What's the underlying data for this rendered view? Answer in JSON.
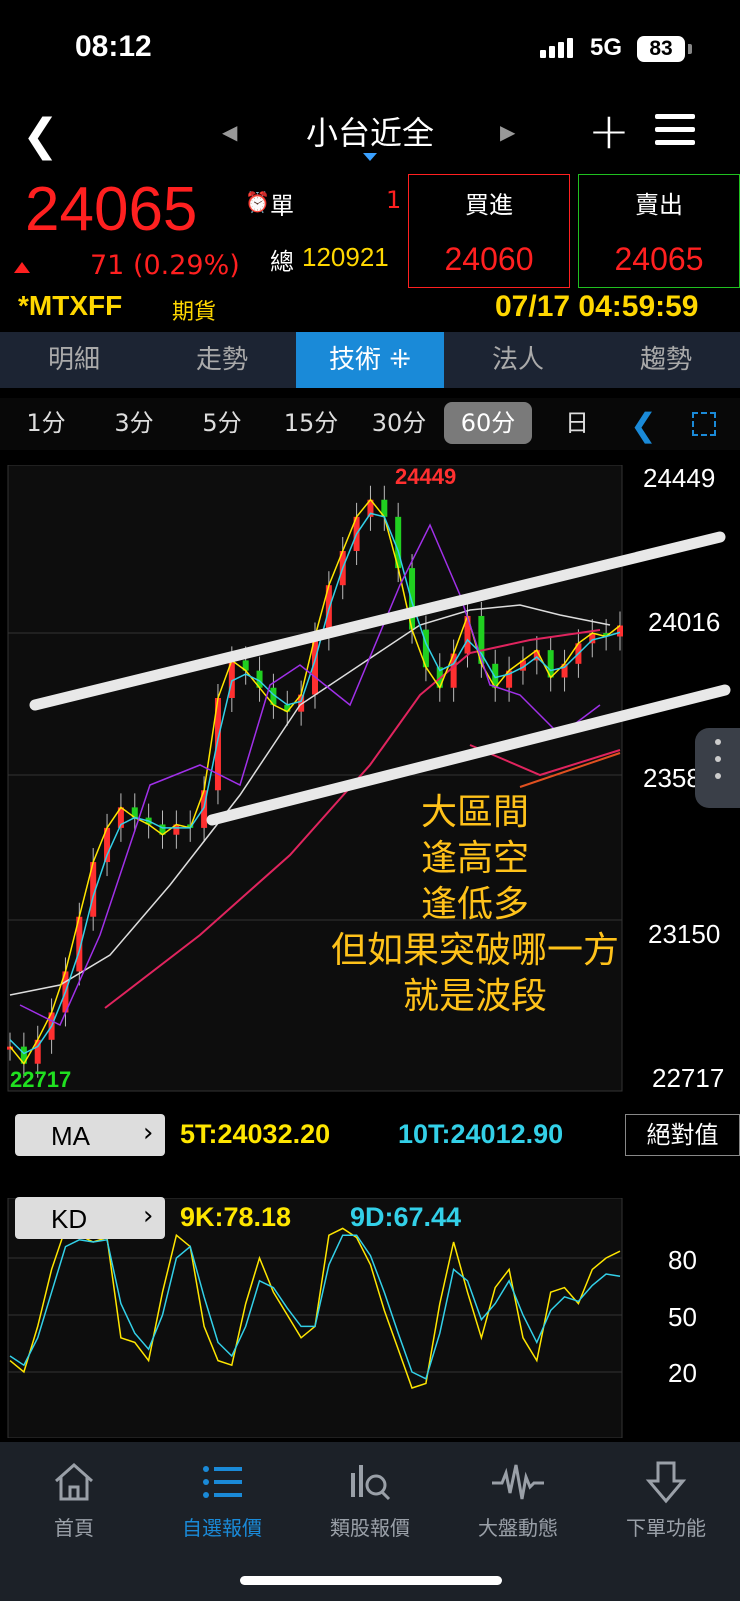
{
  "status": {
    "time": "08:12",
    "network": "5G",
    "battery": "83"
  },
  "nav": {
    "title": "小台近全",
    "back_icon": "back-chevron-icon",
    "prev_icon": "prev-arrow-icon",
    "next_icon": "next-arrow-icon",
    "add_icon": "plus-icon",
    "menu_icon": "menu-icon"
  },
  "quote": {
    "price": "24065",
    "change": "71 (0.29%)",
    "single_label": "單",
    "single_value": "1",
    "total_label": "總",
    "total_value": "120921",
    "buy_label": "買進",
    "buy_value": "24060",
    "sell_label": "賣出",
    "sell_value": "24065",
    "code": "*MTXFF",
    "kind": "期貨",
    "datetime": "07/17 04:59:59",
    "colors": {
      "up": "#ff2020",
      "accent": "#ffd700",
      "buy_border": "#ff2020",
      "sell_border": "#20c020"
    }
  },
  "tabs": [
    {
      "label": "明細"
    },
    {
      "label": "走勢"
    },
    {
      "label": "技術 ⁜"
    },
    {
      "label": "法人"
    },
    {
      "label": "趨勢"
    }
  ],
  "active_tab": 2,
  "periods": [
    {
      "label": "1分"
    },
    {
      "label": "3分"
    },
    {
      "label": "5分"
    },
    {
      "label": "15分"
    },
    {
      "label": "30分"
    },
    {
      "label": "60分"
    },
    {
      "label": "日"
    }
  ],
  "active_period": 5,
  "chart": {
    "price_axis": [
      "24449",
      "24016",
      "23583",
      "23150",
      "22717"
    ],
    "high_label": "24449",
    "low_label": "22717"
  },
  "ma": {
    "label": "MA",
    "ma5": "5T:24032.20",
    "ma10": "10T:24012.90",
    "abs_button": "絕對值",
    "colors": {
      "ma5": "#ffe600",
      "ma10": "#33d0e8"
    }
  },
  "kd": {
    "label": "KD",
    "k": "9K:78.18",
    "d": "9D:67.44",
    "axis": [
      "80",
      "50",
      "20"
    ],
    "colors": {
      "k": "#ffe600",
      "d": "#33d0e8"
    }
  },
  "annotation": [
    "大區間",
    "逢高空",
    "逢低多",
    "但如果突破哪一方",
    "就是波段"
  ],
  "bottom_nav": [
    {
      "label": "首頁",
      "icon": "home-icon"
    },
    {
      "label": "自選報價",
      "icon": "list-icon"
    },
    {
      "label": "類股報價",
      "icon": "sector-search-icon"
    },
    {
      "label": "大盤動態",
      "icon": "pulse-icon"
    },
    {
      "label": "下單功能",
      "icon": "order-down-icon"
    }
  ],
  "active_bottom": 1,
  "chart_data": {
    "type": "line",
    "title": "",
    "ylim": [
      22717,
      24449
    ],
    "series": [
      {
        "name": "5T",
        "color": "#ffe600",
        "values": [
          22800,
          22750,
          22820,
          22900,
          23020,
          23180,
          23340,
          23440,
          23500,
          23470,
          23450,
          23420,
          23450,
          23440,
          23550,
          23820,
          23930,
          23900,
          23850,
          23800,
          23780,
          23830,
          24000,
          24150,
          24250,
          24350,
          24400,
          24350,
          24200,
          24020,
          23910,
          23850,
          23950,
          24060,
          23920,
          23850,
          23900,
          23930,
          23960,
          23880,
          23920,
          23980,
          24010,
          24000,
          24032
        ]
      },
      {
        "name": "10T",
        "color": "#33d0e8",
        "values": [
          22820,
          22780,
          22800,
          22860,
          22960,
          23080,
          23240,
          23360,
          23450,
          23470,
          23460,
          23440,
          23440,
          23440,
          23500,
          23700,
          23870,
          23890,
          23870,
          23830,
          23800,
          23810,
          23930,
          24080,
          24200,
          24300,
          24360,
          24350,
          24250,
          24100,
          23980,
          23900,
          23920,
          23990,
          23950,
          23880,
          23890,
          23910,
          23940,
          23900,
          23910,
          23950,
          23990,
          24000,
          24012
        ]
      }
    ],
    "kd": {
      "k": [
        30,
        25,
        45,
        70,
        88,
        85,
        82,
        84,
        40,
        38,
        30,
        60,
        85,
        80,
        45,
        30,
        28,
        55,
        75,
        60,
        50,
        40,
        45,
        85,
        88,
        84,
        72,
        52,
        35,
        18,
        20,
        55,
        82,
        60,
        40,
        62,
        70,
        40,
        30,
        60,
        62,
        55,
        70,
        75,
        78
      ],
      "d": [
        32,
        28,
        40,
        60,
        80,
        83,
        82,
        83,
        55,
        42,
        35,
        50,
        75,
        80,
        58,
        38,
        32,
        45,
        65,
        62,
        53,
        45,
        45,
        72,
        85,
        85,
        76,
        60,
        42,
        25,
        22,
        42,
        70,
        65,
        48,
        55,
        65,
        50,
        38,
        52,
        58,
        56,
        63,
        68,
        67
      ]
    }
  }
}
